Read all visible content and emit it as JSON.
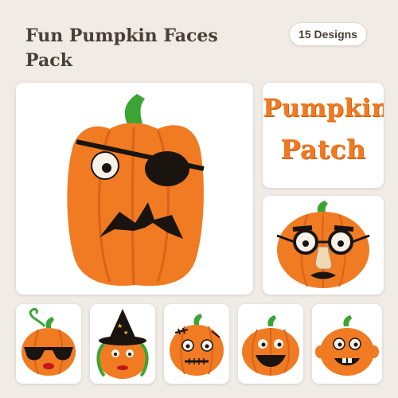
{
  "header": {
    "title_line1": "Fun Pumpkin Faces",
    "title_line2": "Pack",
    "badge": "15 Designs"
  },
  "patch": {
    "line1": "Pumpkin",
    "line2": "Patch"
  },
  "colors": {
    "background": "#f1ebe6",
    "pumpkin": "#f07b22",
    "pumpkin_rib": "#d9631a",
    "stem": "#3aa535",
    "text_dark": "#4a3f35",
    "black": "#1a1410"
  },
  "designs": [
    {
      "name": "eyepatch-pumpkin",
      "icon": "pirate-pumpkin-icon"
    },
    {
      "name": "pumpkin-patch-text",
      "icon": "pumpkin-patch-text"
    },
    {
      "name": "disguise-glasses-pumpkin",
      "icon": "disguise-pumpkin-icon"
    },
    {
      "name": "sunglasses-pumpkin",
      "icon": "sunglasses-pumpkin-icon"
    },
    {
      "name": "witch-pumpkin",
      "icon": "witch-pumpkin-icon"
    },
    {
      "name": "zombie-pumpkin",
      "icon": "zombie-pumpkin-icon"
    },
    {
      "name": "happy-pumpkin",
      "icon": "happy-pumpkin-icon"
    },
    {
      "name": "toothy-pumpkin",
      "icon": "toothy-pumpkin-icon"
    }
  ]
}
